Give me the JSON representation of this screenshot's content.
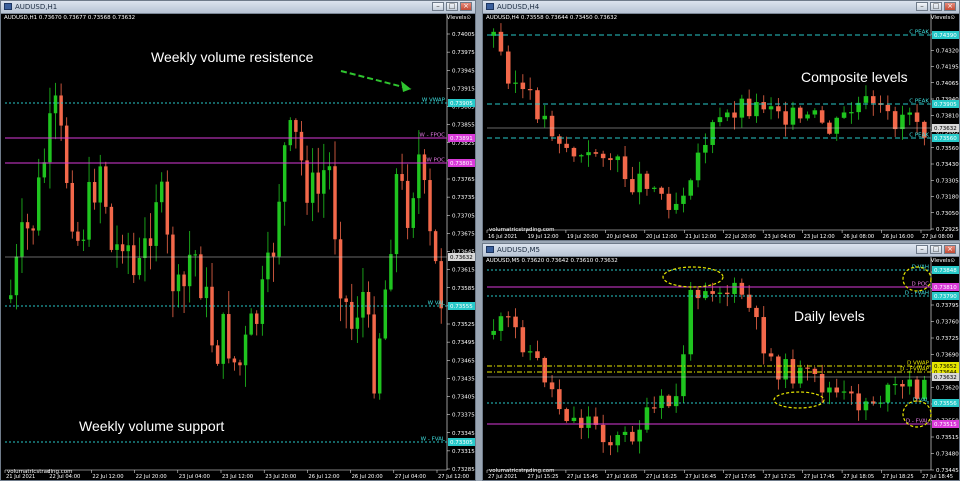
{
  "colors": {
    "bull": "#1fc41f",
    "bear": "#f2684a",
    "axis": "#ffffff",
    "cyan": "#27c9c9",
    "magenta": "#d93ad9",
    "yellow": "#e6e600",
    "lightgrey": "#d0d0d0"
  },
  "watermark": "volumatricstrading.com",
  "windows": [
    {
      "title": "AUDUSD,H1",
      "info": "AUDUSD,H1  0.73670 0.73677 0.73568 0.73632",
      "indicator": "Vlevels⊙",
      "annotations": [
        "Weekly volume resistence",
        "Weekly volume support"
      ],
      "yticks": [
        "0.74005",
        "0.73975",
        "0.73945",
        "0.73915",
        "0.73885",
        "0.73855",
        "0.73825",
        "0.73795",
        "0.73765",
        "0.73735",
        "0.73705",
        "0.73675",
        "0.73645",
        "0.73615",
        "0.73585",
        "0.73555",
        "0.73525",
        "0.73495",
        "0.73465",
        "0.73435",
        "0.73405",
        "0.73375",
        "0.73345",
        "0.73315",
        "0.73285"
      ],
      "xticks": [
        "21 Jul 2021",
        "22 Jul 04:00",
        "22 Jul 12:00",
        "22 Jul 20:00",
        "23 Jul 04:00",
        "23 Jul 12:00",
        "23 Jul 20:00",
        "26 Jul 12:00",
        "26 Jul 20:00",
        "27 Jul 04:00",
        "27 Jul 12:00"
      ],
      "levels": [
        {
          "label": "W VWAP",
          "value": "0.73905"
        },
        {
          "label": "W - FPOC",
          "value": "0.73891"
        },
        {
          "label": "W POC",
          "value": "0.73801"
        },
        {
          "label": "",
          "value": "0.73632"
        },
        {
          "label": "W VAL",
          "value": "0.73555"
        },
        {
          "label": "W - FVAL",
          "value": "0.73305"
        }
      ]
    },
    {
      "title": "AUDUSD,H4",
      "info": "AUDUSD,H4  0.73558 0.73644 0.73450 0.73632",
      "indicator": "Vlevels⊙",
      "annotations": [
        "Composite levels"
      ],
      "yticks": [
        "0.74445",
        "0.74320",
        "0.74195",
        "0.74065",
        "0.73940",
        "0.73810",
        "0.73685",
        "0.73560",
        "0.73430",
        "0.73305",
        "0.73180",
        "0.73050",
        "0.72925"
      ],
      "xticks": [
        "16 Jul 2021",
        "19 Jul 12:00",
        "19 Jul 20:00",
        "20 Jul 04:00",
        "20 Jul 12:00",
        "21 Jul 12:00",
        "22 Jul 20:00",
        "23 Jul 04:00",
        "23 Jul 12:00",
        "26 Jul 08:00",
        "26 Jul 16:00",
        "27 Jul 08:00"
      ],
      "levels": [
        {
          "label": "C PEAK",
          "value": "0.74390"
        },
        {
          "label": "C PEAK",
          "value": "0.73905"
        },
        {
          "label": "",
          "value": "0.73632"
        },
        {
          "label": "C PEAK",
          "value": "0.73560"
        }
      ]
    },
    {
      "title": "AUDUSD,M5",
      "info": "AUDUSD,M5  0.73620 0.73642 0.73610 0.73632",
      "indicator": "Vlevels⊙",
      "annotations": [
        "Daily levels"
      ],
      "yticks": [
        "0.73865",
        "0.73830",
        "0.73795",
        "0.73760",
        "0.73725",
        "0.73690",
        "0.73655",
        "0.73620",
        "0.73585",
        "0.73550",
        "0.73515",
        "0.73480",
        "0.73445"
      ],
      "xticks": [
        "27 Jul 2021",
        "27 Jul 15:25",
        "27 Jul 15:45",
        "27 Jul 16:05",
        "27 Jul 16:25",
        "27 Jul 16:45",
        "27 Jul 17:05",
        "27 Jul 17:25",
        "27 Jul 17:45",
        "27 Jul 18:05",
        "27 Jul 18:25",
        "27 Jul 18:45"
      ],
      "levels": [
        {
          "label": "D VAH",
          "value": "0.73848"
        },
        {
          "label": "D POC",
          "value": "0.73810"
        },
        {
          "label": "D - FVAH",
          "value": "0.73790"
        },
        {
          "label": "D VWAP",
          "value": "0.73652"
        },
        {
          "label": "D - FVWAP",
          "value": "0.73644"
        },
        {
          "label": "",
          "value": "0.73632"
        },
        {
          "label": "D VAL",
          "value": "0.73556"
        },
        {
          "label": "D - FVAL",
          "value": "0.73515"
        }
      ]
    }
  ]
}
